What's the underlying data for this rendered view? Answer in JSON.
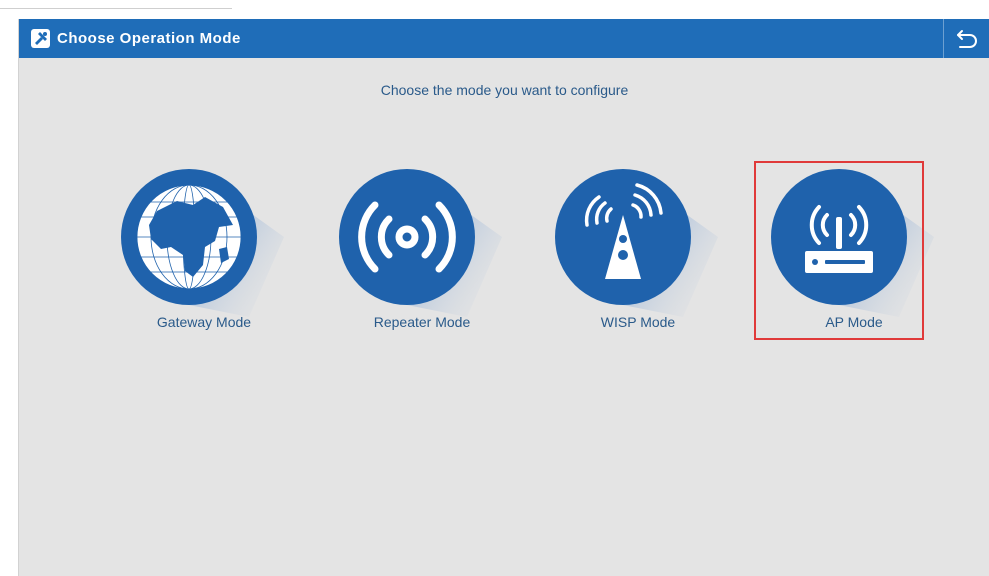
{
  "header": {
    "title": "Choose Operation Mode",
    "title_icon": "wizard-icon",
    "back_icon": "back-arrow-icon"
  },
  "main": {
    "subtitle": "Choose the mode you want to configure",
    "modes": [
      {
        "label": "Gateway Mode",
        "icon": "globe-icon"
      },
      {
        "label": "Repeater Mode",
        "icon": "wireless-waves-icon"
      },
      {
        "label": "WISP Mode",
        "icon": "antenna-tower-icon"
      },
      {
        "label": "AP Mode",
        "icon": "router-icon",
        "highlighted": true
      }
    ]
  },
  "colors": {
    "header_bg": "#1f6db8",
    "disc": "#1f62ac",
    "disc_shadow": "#5b8fd0",
    "panel_bg": "#e4e4e4",
    "label": "#2a5a8a",
    "highlight": "#e03a3a"
  }
}
